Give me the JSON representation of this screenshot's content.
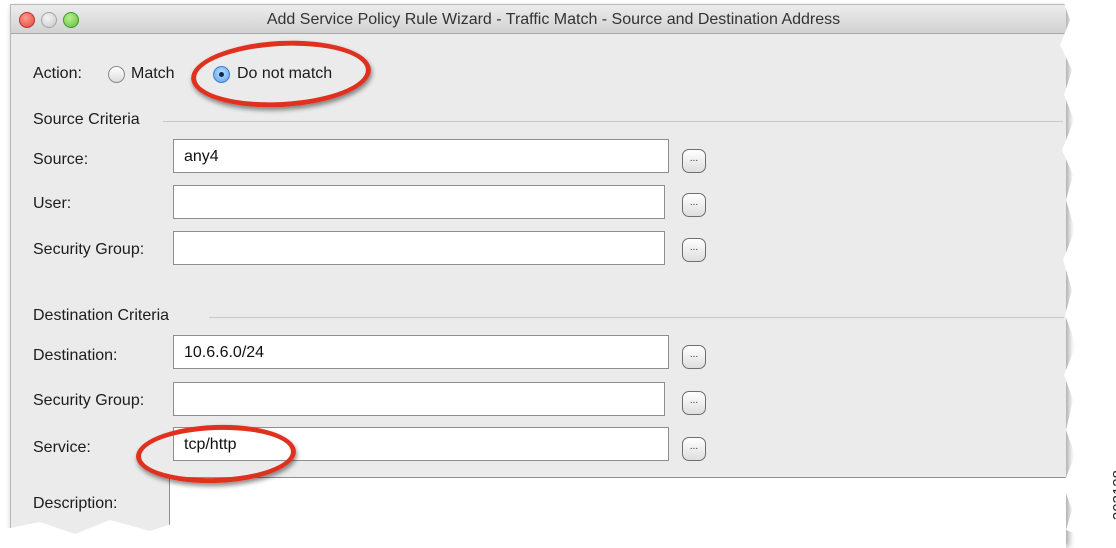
{
  "window": {
    "title": "Add Service Policy Rule Wizard - Traffic Match - Source and Destination Address"
  },
  "action": {
    "label": "Action:",
    "options": [
      {
        "label": "Match",
        "selected": false
      },
      {
        "label": "Do not match",
        "selected": true
      }
    ]
  },
  "source_criteria": {
    "heading": "Source Criteria",
    "fields": [
      {
        "label": "Source:",
        "value": "any4"
      },
      {
        "label": "User:",
        "value": ""
      },
      {
        "label": "Security Group:",
        "value": ""
      }
    ]
  },
  "destination_criteria": {
    "heading": "Destination Criteria",
    "fields": [
      {
        "label": "Destination:",
        "value": "10.6.6.0/24"
      },
      {
        "label": "Security Group:",
        "value": ""
      },
      {
        "label": "Service:",
        "value": "tcp/http"
      }
    ]
  },
  "description": {
    "label": "Description:",
    "value": ""
  },
  "browse_button_label": "...",
  "figure_number": "303128",
  "colors": {
    "highlight_ring": "#e0301e",
    "radio_selected": "#5a9de6"
  }
}
